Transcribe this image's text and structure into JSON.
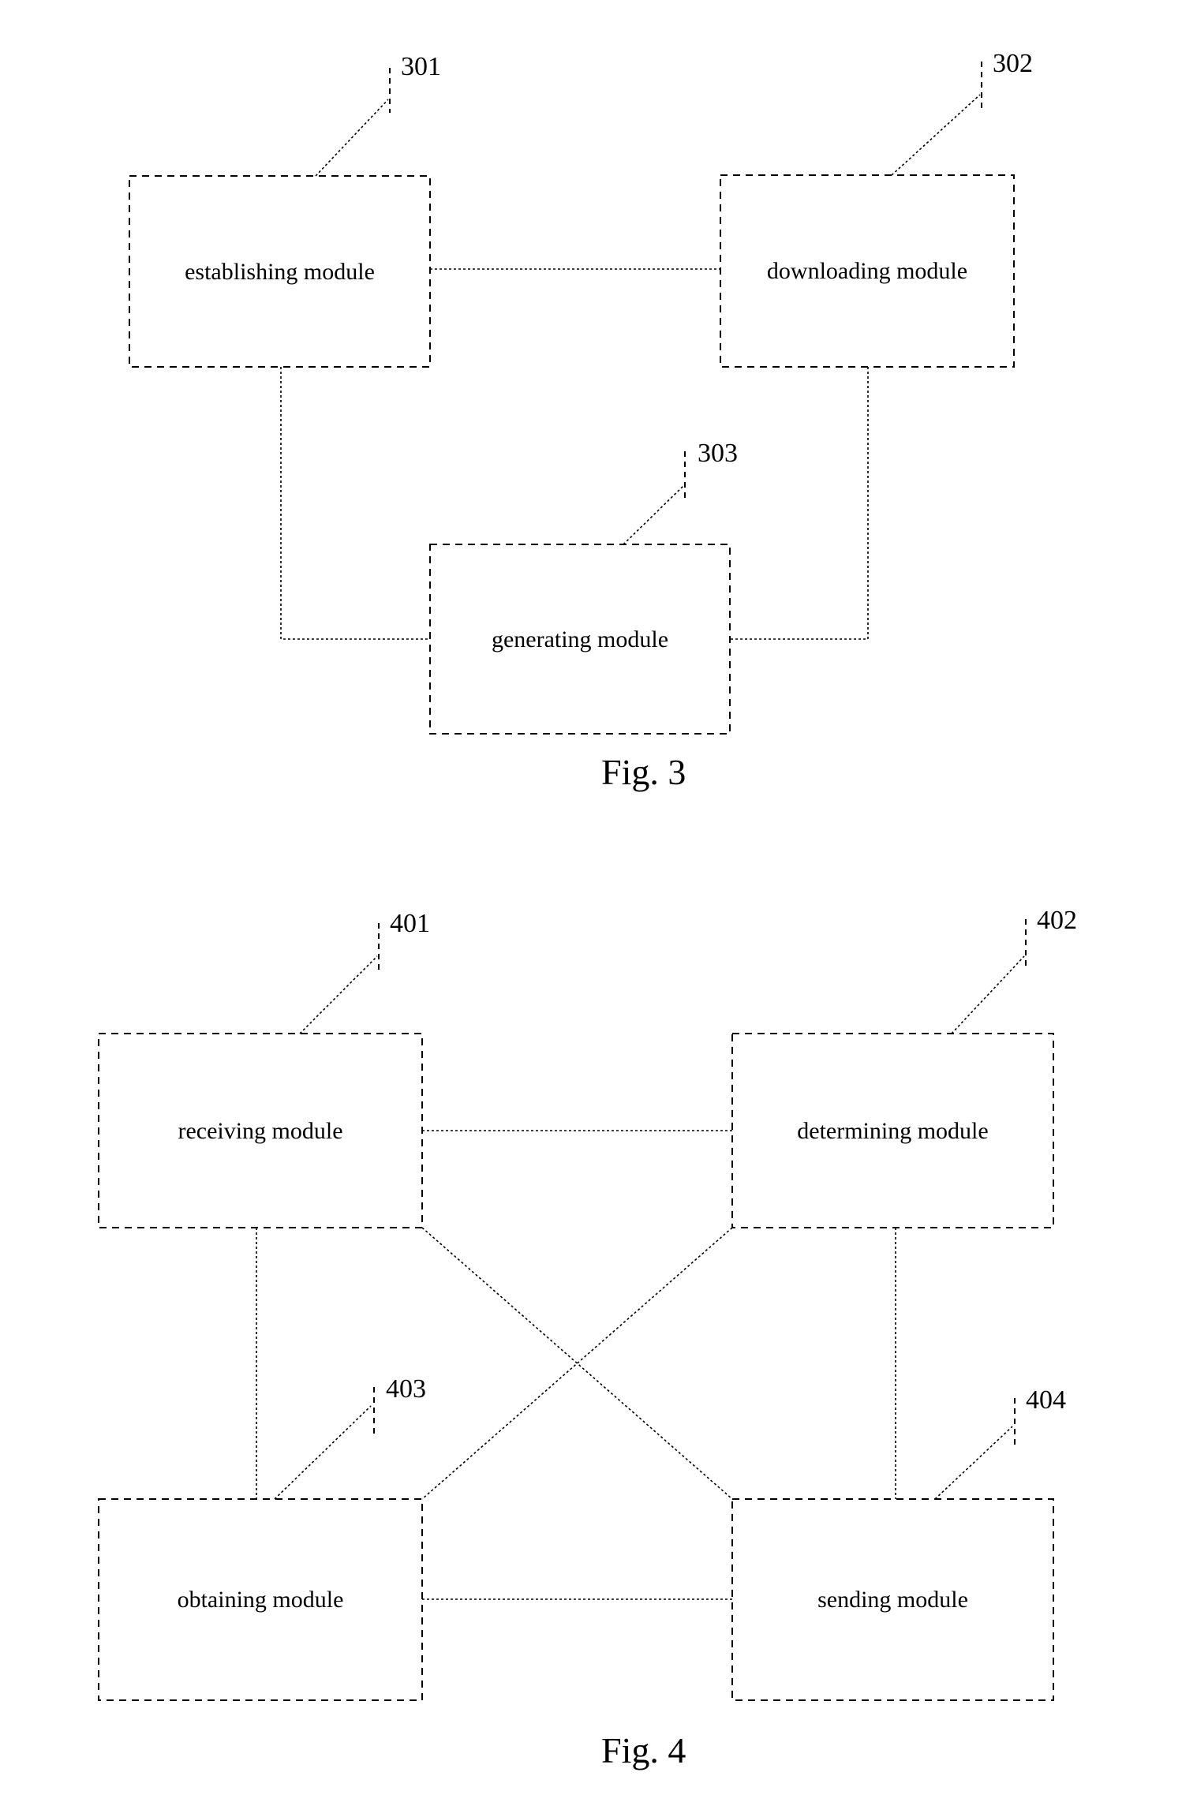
{
  "document": {
    "type": "patent-drawing-sheet",
    "figures": [
      {
        "id": "fig3",
        "caption": "Fig. 3",
        "blocks": [
          {
            "ref": "301",
            "label": "establishing module"
          },
          {
            "ref": "302",
            "label": "downloading module"
          },
          {
            "ref": "303",
            "label": "generating module"
          }
        ]
      },
      {
        "id": "fig4",
        "caption": "Fig. 4",
        "blocks": [
          {
            "ref": "401",
            "label": "receiving module"
          },
          {
            "ref": "402",
            "label": "determining module"
          },
          {
            "ref": "403",
            "label": "obtaining module"
          },
          {
            "ref": "404",
            "label": "sending module"
          }
        ]
      }
    ]
  },
  "fig3": {
    "caption": "Fig. 3",
    "establishing": {
      "label": "establishing module",
      "ref": "301"
    },
    "downloading": {
      "label": "downloading module",
      "ref": "302"
    },
    "generating": {
      "label": "generating module",
      "ref": "303"
    }
  },
  "fig4": {
    "caption": "Fig. 4",
    "receiving": {
      "label": "receiving module",
      "ref": "401"
    },
    "determining": {
      "label": "determining module",
      "ref": "402"
    },
    "obtaining": {
      "label": "obtaining module",
      "ref": "403"
    },
    "sending": {
      "label": "sending module",
      "ref": "404"
    }
  },
  "style": {
    "ink": "#000000",
    "paper": "#ffffff"
  }
}
